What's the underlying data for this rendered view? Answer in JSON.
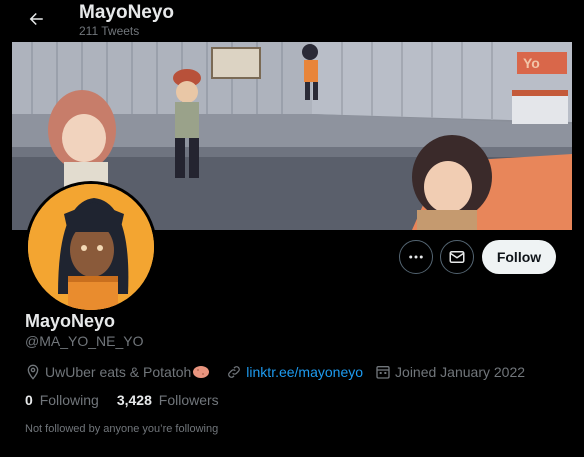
{
  "header": {
    "back_icon": "arrow-left-icon",
    "name": "MayoNeyo",
    "tweet_count": "211 Tweets"
  },
  "banner": {
    "description_icon": "pixel-art-street-scene",
    "sign_text": "Yo"
  },
  "actions": {
    "more_icon": "ellipsis-icon",
    "message_icon": "envelope-icon",
    "follow_label": "Follow"
  },
  "profile": {
    "display_name": "MayoNeyo",
    "handle": "@MA_YO_NE_YO",
    "location": "UwUber eats & Potatoh",
    "location_emoji_icon": "potato-icon",
    "link": "linktr.ee/mayoneyo",
    "joined": "Joined January 2022",
    "following_count": "0",
    "following_label": "Following",
    "followers_count": "3,428",
    "followers_label": "Followers",
    "followed_by_note": "Not followed by anyone you’re following"
  },
  "colors": {
    "background": "#000000",
    "text_primary": "#e7e9ea",
    "text_secondary": "#71767b",
    "link": "#1d9bf0",
    "follow_bg": "#eff3f4",
    "avatar_bg": "#f3a531"
  }
}
